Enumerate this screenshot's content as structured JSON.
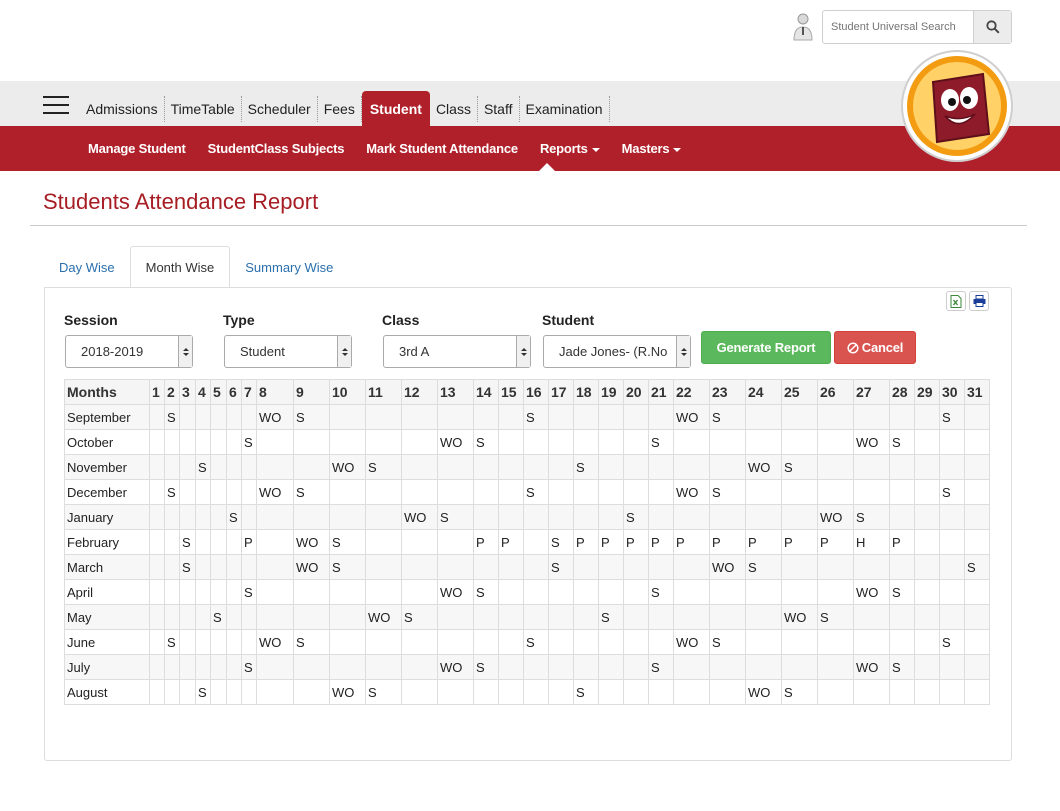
{
  "search": {
    "placeholder": "Student Universal Search"
  },
  "nav": {
    "items": [
      "Admissions",
      "TimeTable",
      "Scheduler",
      "Fees",
      "Student",
      "Class",
      "Staff",
      "Examination"
    ],
    "active": "Student"
  },
  "subnav": {
    "items": [
      {
        "label": "Manage Student",
        "dropdown": false
      },
      {
        "label": "StudentClass Subjects",
        "dropdown": false
      },
      {
        "label": "Mark Student Attendance",
        "dropdown": false
      },
      {
        "label": "Reports",
        "dropdown": true
      },
      {
        "label": "Masters",
        "dropdown": true
      }
    ]
  },
  "page": {
    "title": "Students Attendance Report"
  },
  "tabs": [
    {
      "label": "Day Wise",
      "active": false
    },
    {
      "label": "Month Wise",
      "active": true
    },
    {
      "label": "Summary Wise",
      "active": false
    }
  ],
  "form": {
    "session": {
      "label": "Session",
      "value": "2018-2019"
    },
    "type": {
      "label": "Type",
      "value": "Student"
    },
    "class": {
      "label": "Class",
      "value": "3rd A"
    },
    "student": {
      "label": "Student",
      "value": "Jade Jones- (R.No"
    },
    "generate_label": "Generate Report",
    "cancel_label": "Cancel"
  },
  "colors": {
    "brand_red": "#b0202a",
    "title_red": "#a71d24",
    "green": "#5cb85c",
    "danger": "#d9534f",
    "link_blue": "#2a6fad"
  },
  "table": {
    "first_header": "Months",
    "days": [
      "1",
      "2",
      "3",
      "4",
      "5",
      "6",
      "7",
      "8",
      "9",
      "10",
      "11",
      "12",
      "13",
      "14",
      "15",
      "16",
      "17",
      "18",
      "19",
      "20",
      "21",
      "22",
      "23",
      "24",
      "25",
      "26",
      "27",
      "28",
      "29",
      "30",
      "31"
    ],
    "rows": [
      {
        "month": "September",
        "cells": {
          "2": "S",
          "8": "WO",
          "9": "S",
          "16": "S",
          "22": "WO",
          "23": "S",
          "30": "S"
        }
      },
      {
        "month": "October",
        "cells": {
          "7": "S",
          "13": "WO",
          "14": "S",
          "21": "S",
          "27": "WO",
          "28": "S"
        }
      },
      {
        "month": "November",
        "cells": {
          "4": "S",
          "10": "WO",
          "11": "S",
          "18": "S",
          "24": "WO",
          "25": "S"
        }
      },
      {
        "month": "December",
        "cells": {
          "2": "S",
          "8": "WO",
          "9": "S",
          "16": "S",
          "22": "WO",
          "23": "S",
          "30": "S"
        }
      },
      {
        "month": "January",
        "cells": {
          "6": "S",
          "12": "WO",
          "13": "S",
          "20": "S",
          "26": "WO",
          "27": "S"
        }
      },
      {
        "month": "February",
        "cells": {
          "3": "S",
          "7": "P",
          "9": "WO",
          "10": "S",
          "14": "P",
          "15": "P",
          "17": "S",
          "18": "P",
          "19": "P",
          "20": "P",
          "21": "P",
          "22": "P",
          "23": "P",
          "24": "P",
          "25": "P",
          "26": "P",
          "27": "H",
          "28": "P"
        }
      },
      {
        "month": "March",
        "cells": {
          "3": "S",
          "9": "WO",
          "10": "S",
          "17": "S",
          "23": "WO",
          "24": "S",
          "31": "S"
        }
      },
      {
        "month": "April",
        "cells": {
          "7": "S",
          "13": "WO",
          "14": "S",
          "21": "S",
          "27": "WO",
          "28": "S"
        }
      },
      {
        "month": "May",
        "cells": {
          "5": "S",
          "11": "WO",
          "12": "S",
          "19": "S",
          "25": "WO",
          "26": "S"
        }
      },
      {
        "month": "June",
        "cells": {
          "2": "S",
          "8": "WO",
          "9": "S",
          "16": "S",
          "22": "WO",
          "23": "S",
          "30": "S"
        }
      },
      {
        "month": "July",
        "cells": {
          "7": "S",
          "13": "WO",
          "14": "S",
          "21": "S",
          "27": "WO",
          "28": "S"
        }
      },
      {
        "month": "August",
        "cells": {
          "4": "S",
          "10": "WO",
          "11": "S",
          "18": "S",
          "24": "WO",
          "25": "S"
        }
      }
    ]
  }
}
